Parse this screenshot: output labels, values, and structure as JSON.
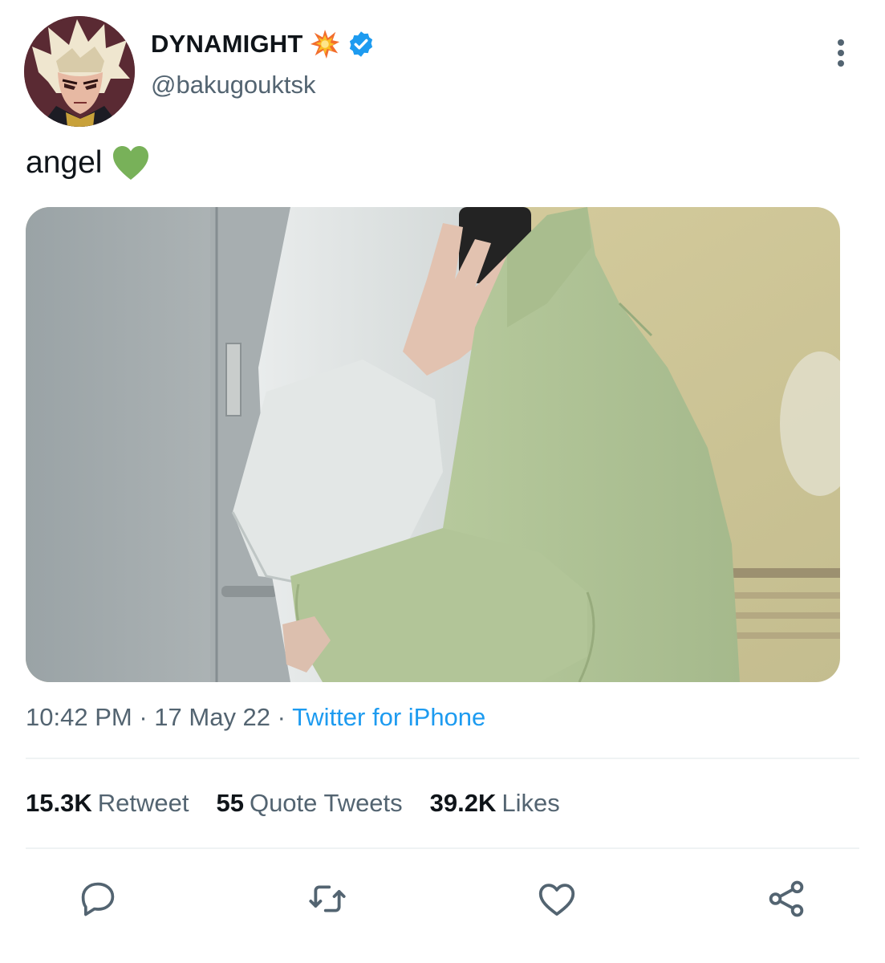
{
  "author": {
    "display_name": "DYNAMIGHT",
    "name_emoji": "collision-emoji",
    "verified": true,
    "handle": "@bakugouktsk",
    "avatar": "anime-character-avatar"
  },
  "tweet": {
    "text": "angel",
    "text_emoji": "green-heart-emoji",
    "media": "photo-two-people-hugging-white-and-green-hoodies",
    "time": "10:42 PM",
    "separator": "·",
    "date": "17 May 22",
    "source": "Twitter for iPhone"
  },
  "stats": [
    {
      "count": "15.3K",
      "label": "Retweet"
    },
    {
      "count": "55",
      "label": "Quote Tweets"
    },
    {
      "count": "39.2K",
      "label": "Likes"
    }
  ],
  "actions": [
    "reply-icon",
    "retweet-icon",
    "like-icon",
    "share-icon"
  ],
  "colors": {
    "text_primary": "#0f1419",
    "text_secondary": "#536471",
    "link": "#1d9bf0",
    "divider": "#eff3f4",
    "verified_badge": "#1d9bf0",
    "heart_emoji": "#78b159"
  }
}
